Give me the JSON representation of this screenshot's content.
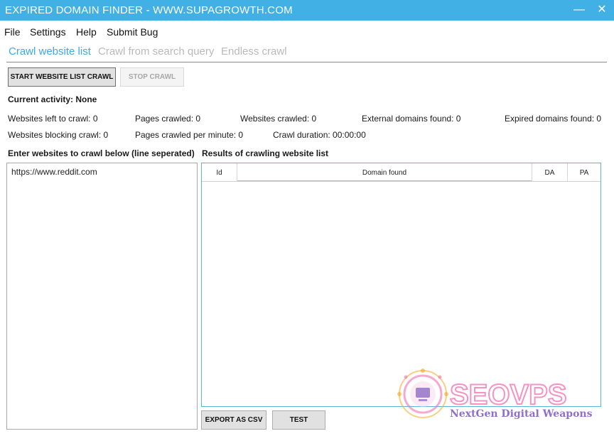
{
  "window": {
    "title": "EXPIRED DOMAIN FINDER - WWW.SUPAGROWTH.COM",
    "minimize_glyph": "—",
    "close_glyph": "✕"
  },
  "menu": {
    "items": [
      "File",
      "Settings",
      "Help",
      "Submit Bug"
    ]
  },
  "tabs": [
    {
      "label": "Crawl website list",
      "active": true
    },
    {
      "label": "Crawl from search query",
      "active": false
    },
    {
      "label": "Endless crawl",
      "active": false
    }
  ],
  "toolbar": {
    "start_label": "START WEBSITE LIST CRAWL",
    "stop_label": "STOP CRAWL"
  },
  "status": {
    "current_activity": "Current activity: None",
    "websites_left": "Websites left to crawl: 0",
    "pages_crawled": "Pages crawled: 0",
    "websites_crawled": "Websites crawled: 0",
    "external_domains": "External domains found: 0",
    "expired_domains": "Expired domains found: 0",
    "websites_blocking": "Websites blocking crawl: 0",
    "pages_per_minute": "Pages crawled per minute: 0",
    "crawl_duration": "Crawl duration: 00:00:00"
  },
  "input": {
    "label": "Enter websites to crawl below (line seperated)",
    "value": "https://www.reddit.com"
  },
  "results": {
    "label": "Results of crawling website list",
    "columns": [
      "Id",
      "Domain found",
      "DA",
      "PA"
    ],
    "rows": []
  },
  "actions": {
    "export_label": "EXPORT AS CSV",
    "test_label": "TEST"
  },
  "watermark": {
    "brand": "SEOVPS",
    "tagline": "NextGen Digital Weapons",
    "colors": {
      "pink": "#f06fb0",
      "purple": "#6a3fb8",
      "orange": "#f5a623"
    }
  },
  "colors": {
    "titlebar": "#41b0e4",
    "active_tab": "#41a9dc",
    "inactive_tab": "#b9b9b9",
    "grid_border": "#5bb5d8"
  }
}
